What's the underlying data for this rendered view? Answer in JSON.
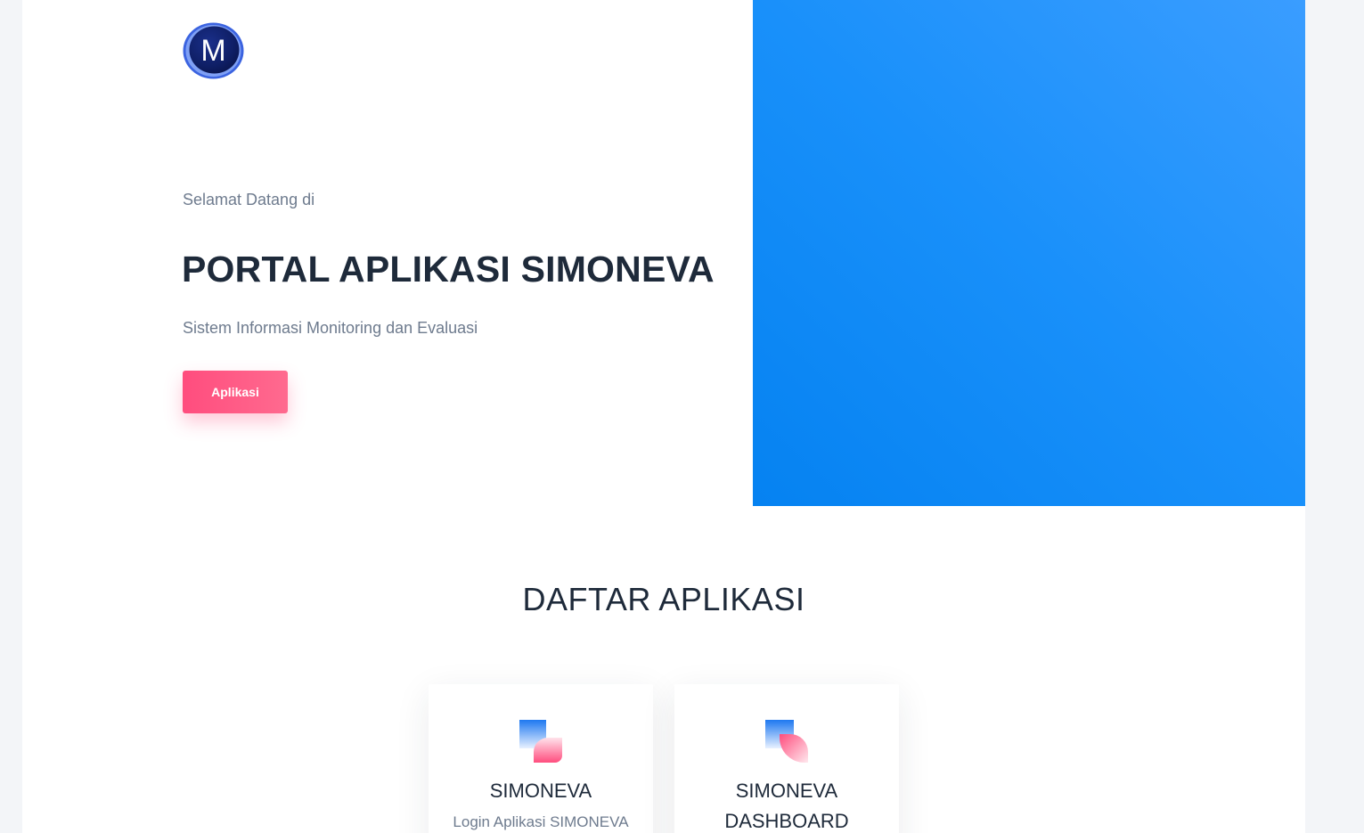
{
  "hero": {
    "logo_letter": "M",
    "welcome": "Selamat Datang di",
    "title": "PORTAL APLIKASI SIMONEVA",
    "subtitle": "Sistem Informasi Monitoring dan Evaluasi",
    "button_label": "Aplikasi"
  },
  "apps_section": {
    "title": "DAFTAR APLIKASI",
    "cards": [
      {
        "title": "SIMONEVA",
        "description": "Login Aplikasi SIMONEVA",
        "icon": "app-shape-icon"
      },
      {
        "title": "SIMONEVA DASHBOARD",
        "description": "",
        "icon": "dashboard-shape-icon"
      }
    ]
  },
  "colors": {
    "accent_pink": "#ff4d7e",
    "hero_blue": "#0582f1",
    "text_dark": "#1e2a3a",
    "text_muted": "#6e7b8e"
  }
}
